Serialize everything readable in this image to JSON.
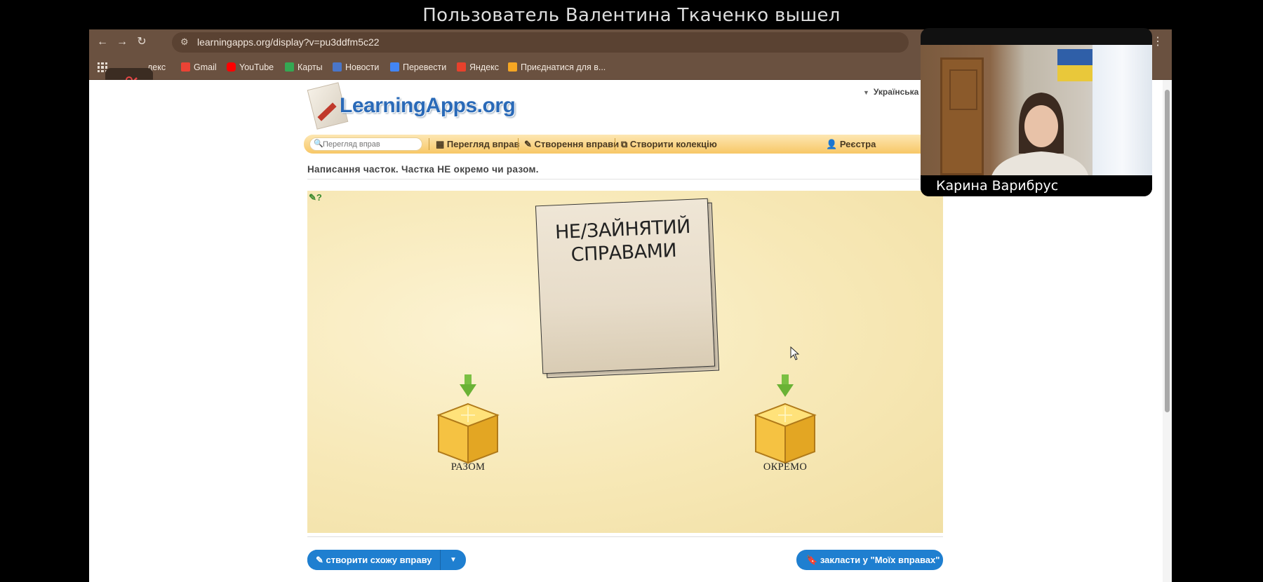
{
  "meeting": {
    "notice": "Пользователь Валентина Ткаченко вышел",
    "participant_name": "Карина Варибрус"
  },
  "browser": {
    "url": "learningapps.org/display?v=pu3ddfm5c22",
    "bookmarks": [
      {
        "label": "декс",
        "icon_color": "#e8412c"
      },
      {
        "label": "Gmail",
        "icon_color": "#ea4335"
      },
      {
        "label": "YouTube",
        "icon_color": "#ff0000"
      },
      {
        "label": "Карты",
        "icon_color": "#34a853"
      },
      {
        "label": "Новости",
        "icon_color": "#4a76c9"
      },
      {
        "label": "Перевести",
        "icon_color": "#4285f4"
      },
      {
        "label": "Яндекс",
        "icon_color": "#e8412c"
      },
      {
        "label": "Приєднатися для в...",
        "icon_color": "#f5a623"
      }
    ]
  },
  "site": {
    "logo": "LearningApps.org",
    "language": "Українська",
    "search_placeholder": "Перегляд вправ",
    "nav": {
      "browse": "Перегляд вправ",
      "create": "Створення вправи",
      "collection": "Створити колекцію",
      "register": "Реєстра"
    }
  },
  "exercise": {
    "title": "Написання часток. Частка НЕ окремо чи разом.",
    "card_text": "НЕ/ЗАЙНЯТИЙ СПРАВАМИ",
    "boxes": {
      "left": "РАЗОМ",
      "right": "ОКРЕМО"
    }
  },
  "actions": {
    "create_similar": "створити схожу вправу",
    "save_to_mine": "закласти у \"Моїх вправах\""
  },
  "colors": {
    "browser_chrome": "#6a5140",
    "nav_bar": "#f7c766",
    "button_blue": "#1f7fd0",
    "stage_bg": "#f7e8b6"
  }
}
